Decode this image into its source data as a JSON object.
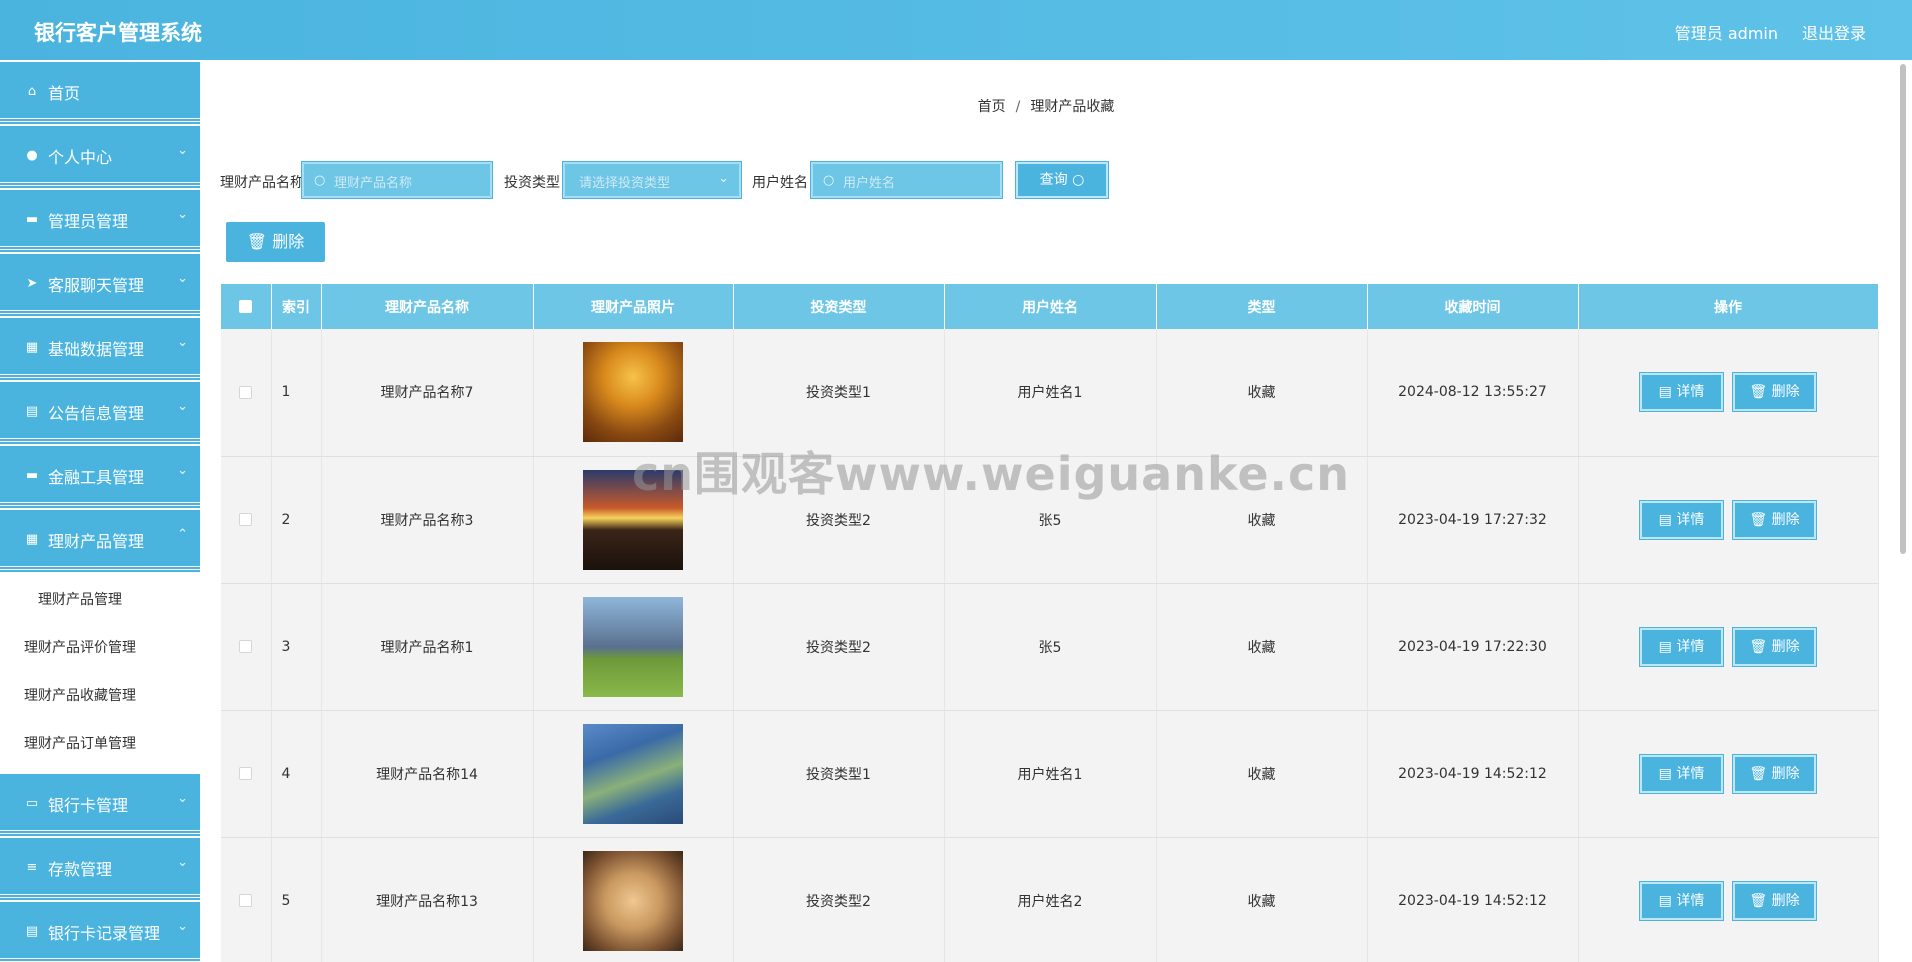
{
  "header": {
    "title": "银行客户管理系统",
    "user": "管理员 admin",
    "logout": "退出登录"
  },
  "sidebar": {
    "items": [
      {
        "label": "首页",
        "icon": "home-icon",
        "glyph": "⌂",
        "arrow": ""
      },
      {
        "label": "个人中心",
        "icon": "user-icon",
        "glyph": "●",
        "arrow": "⌄"
      },
      {
        "label": "管理员管理",
        "icon": "admin-icon",
        "glyph": "▬",
        "arrow": "⌄"
      },
      {
        "label": "客服聊天管理",
        "icon": "send-icon",
        "glyph": "➤",
        "arrow": "⌄"
      },
      {
        "label": "基础数据管理",
        "icon": "grid-icon",
        "glyph": "▦",
        "arrow": "⌄"
      },
      {
        "label": "公告信息管理",
        "icon": "notice-icon",
        "glyph": "▤",
        "arrow": "⌄"
      },
      {
        "label": "金融工具管理",
        "icon": "tool-icon",
        "glyph": "▬",
        "arrow": "⌄"
      },
      {
        "label": "理财产品管理",
        "icon": "grid-icon",
        "glyph": "▦",
        "arrow": "⌃"
      }
    ],
    "subitems": [
      "理财产品管理",
      "理财产品评价管理",
      "理财产品收藏管理",
      "理财产品订单管理"
    ],
    "items_after": [
      {
        "label": "银行卡管理",
        "icon": "card-icon",
        "glyph": "▭",
        "arrow": "⌄"
      },
      {
        "label": "存款管理",
        "icon": "list-icon",
        "glyph": "≡",
        "arrow": "⌄"
      },
      {
        "label": "银行卡记录管理",
        "icon": "record-icon",
        "glyph": "▤",
        "arrow": "⌄"
      }
    ]
  },
  "breadcrumb": {
    "home": "首页",
    "sep": "/",
    "current": "理财产品收藏"
  },
  "search": {
    "name_label": "理财产品名称",
    "name_placeholder": "理财产品名称",
    "type_label": "投资类型",
    "type_placeholder": "请选择投资类型",
    "user_label": "用户姓名",
    "user_placeholder": "用户姓名",
    "query_button": "查询"
  },
  "toolbar": {
    "delete_label": "删除"
  },
  "table": {
    "columns": [
      "索引",
      "理财产品名称",
      "理财产品照片",
      "投资类型",
      "用户姓名",
      "类型",
      "收藏时间",
      "操作"
    ],
    "detail_label": "详情",
    "delete_label": "删除",
    "rows": [
      {
        "index": "1",
        "name": "理财产品名称7",
        "photo": "autumn-trees",
        "invest_type": "投资类型1",
        "user": "用户姓名1",
        "type": "收藏",
        "time": "2024-08-12 13:55:27"
      },
      {
        "index": "2",
        "name": "理财产品名称3",
        "photo": "sunset-road",
        "invest_type": "投资类型2",
        "user": "张5",
        "type": "收藏",
        "time": "2023-04-19 17:27:32"
      },
      {
        "index": "3",
        "name": "理财产品名称1",
        "photo": "mountain-meadow",
        "invest_type": "投资类型2",
        "user": "张5",
        "type": "收藏",
        "time": "2023-04-19 17:22:30"
      },
      {
        "index": "4",
        "name": "理财产品名称14",
        "photo": "river-delta",
        "invest_type": "投资类型1",
        "user": "用户姓名1",
        "type": "收藏",
        "time": "2023-04-19 14:52:12"
      },
      {
        "index": "5",
        "name": "理财产品名称13",
        "photo": "desert-sunset",
        "invest_type": "投资类型2",
        "user": "用户姓名2",
        "type": "收藏",
        "time": "2023-04-19 14:52:12"
      }
    ]
  },
  "watermark": "cn围观客www.weiguanke.cn",
  "colors": {
    "primary": "#4ab4df",
    "header_row": "#6dc6e6",
    "row_bg": "#f3f3f3"
  }
}
